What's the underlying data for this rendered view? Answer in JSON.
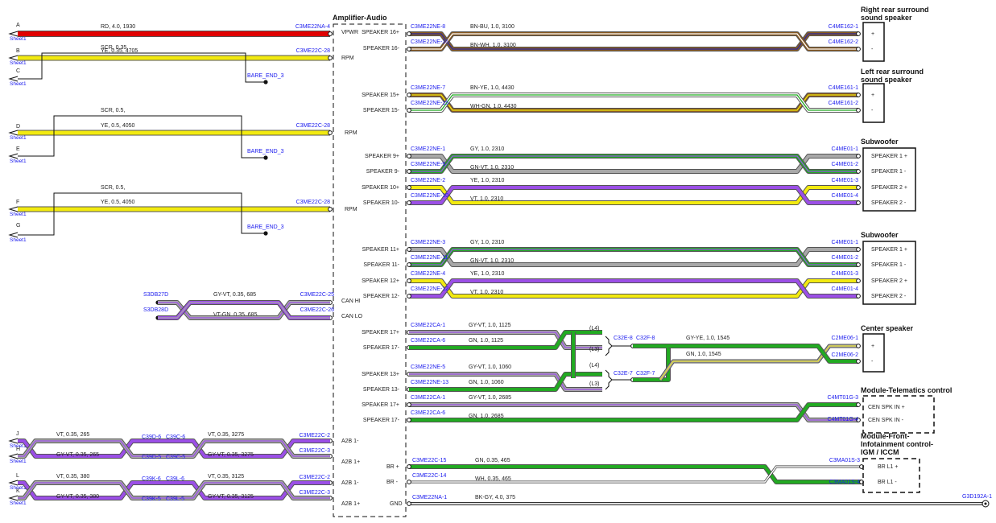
{
  "colors": {
    "RD": "#e00000",
    "YE": "#f2ea10",
    "BN": "#8a5a20",
    "BU": "#2a2aa0",
    "WH": "#ffffff",
    "GN": "#22aa22",
    "GY": "#a8a8a8",
    "VT": "#9b4fe6",
    "BK": "#222222",
    "connector_text": "#1a1aee"
  },
  "amplifier": {
    "title": "Amplifier-Audio",
    "pins": [
      "SPEAKER 16+",
      "SPEAKER 16-",
      "SPEAKER 15+",
      "SPEAKER 15-",
      "SPEAKER 9+",
      "SPEAKER 9-",
      "SPEAKER 10+",
      "SPEAKER 10-",
      "SPEAKER 11+",
      "SPEAKER 11-",
      "SPEAKER 12+",
      "SPEAKER 12-",
      "SPEAKER 17+",
      "SPEAKER 17-",
      "SPEAKER 13+",
      "SPEAKER 13-",
      "SPEAKER 17+",
      "SPEAKER 17-"
    ],
    "pins_small": [
      "VPWR",
      "RPM",
      "RPM",
      "RPM",
      "CAN HI",
      "CAN LO",
      "A2B 1-",
      "A2B 1+",
      "A2B 1-",
      "A2B 1+",
      "BR +",
      "BR -",
      "GND"
    ]
  },
  "left_wires": [
    {
      "letter": "A",
      "sheet": "Sheet1",
      "label": "RD, 4.0, 1930",
      "conn": "C3ME22NA-4"
    },
    {
      "letter": "B",
      "sheet": "Sheet1",
      "label": "YE, 0.35, 4705",
      "conn": "C3ME22C-28",
      "shield": "SCR, 0.35,"
    },
    {
      "letter": "C",
      "sheet": "Sheet1",
      "bare": "BARE_END_3"
    },
    {
      "letter": "D",
      "sheet": "Sheet1",
      "label": "YE, 0.5, 4050",
      "conn": "C3ME22C-28",
      "shield": "SCR, 0.5,"
    },
    {
      "letter": "E",
      "sheet": "Sheet1",
      "bare": "BARE_END_3"
    },
    {
      "letter": "F",
      "sheet": "Sheet1",
      "label": "YE, 0.5, 4050",
      "conn": "C3ME22C-28",
      "shield": "SCR, 0.5,"
    },
    {
      "letter": "G",
      "sheet": "Sheet1",
      "bare": "BARE_END_3"
    }
  ],
  "can": [
    {
      "from": "S3DB27D",
      "label": "GY-VT, 0.35, 685",
      "conn": "C3ME22C-25"
    },
    {
      "from": "S3DB28D",
      "label": "VT-GN, 0.35, 685",
      "conn": "C3ME22C-26"
    }
  ],
  "a2b": [
    {
      "letter": "J",
      "sheet": "Sheet1",
      "l1": "VT, 0.35, 265",
      "c1": "C39D-6",
      "c2": "C39C-6",
      "l2": "VT, 0.35, 3275",
      "conn": "C3ME22C-2"
    },
    {
      "letter": "H",
      "sheet": "Sheet1",
      "l1": "GY-VT, 0.35, 265",
      "c1": "C39D-5",
      "c2": "C39C-5",
      "l2": "GY-VT, 0.35, 3275",
      "conn": "C3ME22C-3"
    },
    {
      "letter": "L",
      "sheet": "Sheet1",
      "l1": "VT, 0.35, 380",
      "c1": "C39K-6",
      "c2": "C39L-6",
      "l2": "VT, 0.35, 3125",
      "conn": "C3ME22C-2"
    },
    {
      "letter": "K",
      "sheet": "Sheet1",
      "l1": "GY-VT, 0.35, 380",
      "c1": "C39K-5",
      "c2": "C39L-5",
      "l2": "GY-VT, 0.35, 3125",
      "conn": "C3ME22C-3"
    }
  ],
  "right_wires": [
    {
      "conn": "C3ME22NE-8",
      "label": "BN-BU, 1.0, 3100",
      "dest": "C4ME162-1"
    },
    {
      "conn": "C3ME22NE-16",
      "label": "BN-WH, 1.0, 3100",
      "dest": "C4ME162-2"
    },
    {
      "conn": "C3ME22NE-7",
      "label": "BN-YE, 1.0, 4430",
      "dest": "C4ME161-1"
    },
    {
      "conn": "C3ME22NE-15",
      "label": "WH-GN, 1.0, 4430",
      "dest": "C4ME161-2"
    },
    {
      "conn": "C3ME22NE-1",
      "label": "GY, 1.0, 2310",
      "dest": "C4ME01-1"
    },
    {
      "conn": "C3ME22NE-9",
      "label": "GN-VT, 1.0, 2310",
      "dest": "C4ME01-2"
    },
    {
      "conn": "C3ME22NE-2",
      "label": "YE, 1.0, 2310",
      "dest": "C4ME01-3"
    },
    {
      "conn": "C3ME22NE-10",
      "label": "VT, 1.0, 2310",
      "dest": "C4ME01-4"
    },
    {
      "conn": "C3ME22NE-3",
      "label": "GY, 1.0, 2310",
      "dest": "C4ME01-1"
    },
    {
      "conn": "C3ME22NE-11",
      "label": "GN-VT, 1.0, 2310",
      "dest": "C4ME01-2"
    },
    {
      "conn": "C3ME22NE-4",
      "label": "YE, 1.0, 2310",
      "dest": "C4ME01-3"
    },
    {
      "conn": "C3ME22NE-12",
      "label": "VT, 1.0, 2310",
      "dest": "C4ME01-4"
    },
    {
      "conn": "C3ME22CA-1",
      "label": "GY-VT, 1.0, 1125"
    },
    {
      "conn": "C3ME22CA-6",
      "label": "GN, 1.0, 1125"
    },
    {
      "conn": "C3ME22NE-5",
      "label": "GY-VT, 1.0, 1060"
    },
    {
      "conn": "C3ME22NE-13",
      "label": "GN, 1.0, 1060"
    },
    {
      "conn": "C3ME22CA-1",
      "label": "GY-VT, 1.0, 2685",
      "dest": "C4MT01G-3"
    },
    {
      "conn": "C3ME22CA-6",
      "label": "GN, 1.0, 2685",
      "dest": "C4MT01G-4"
    },
    {
      "conn": "C3ME22C-15",
      "label": "GN, 0.35, 465",
      "dest": "C3MA01S-3"
    },
    {
      "conn": "C3ME22C-14",
      "label": "WH, 0.35, 465",
      "dest": "C3MA01S-4"
    },
    {
      "conn": "C3ME22NA-1",
      "label": "BK-GY, 4.0, 375",
      "dest": "G3D192A-1"
    }
  ],
  "center": {
    "splice_refs": [
      "(L4)",
      "(L3)",
      "(L4)",
      "(L3)"
    ],
    "c1": "C32E-8",
    "c2": "C32F-8",
    "c3": "C32E-7",
    "c4": "C32F-7",
    "l1": "GY-YE, 1.0, 1545",
    "l2": "GN, 1.0, 1545",
    "d1": "C2ME06-1",
    "d2": "C2ME06-2"
  },
  "components": [
    {
      "title": "Right rear surround\nsound speaker",
      "pins": [
        "+",
        "-"
      ]
    },
    {
      "title": "Left rear surround\nsound speaker",
      "pins": [
        "+",
        "-"
      ]
    },
    {
      "title": "Subwoofer",
      "pins": [
        "SPEAKER 1 +",
        "SPEAKER 1 -",
        "SPEAKER 2 +",
        "SPEAKER 2 -"
      ]
    },
    {
      "title": "Subwoofer",
      "pins": [
        "SPEAKER 1 +",
        "SPEAKER 1 -",
        "SPEAKER 2 +",
        "SPEAKER 2 -"
      ]
    },
    {
      "title": "Center speaker",
      "pins": [
        "+",
        "-"
      ]
    },
    {
      "title": "Module-Telematics control",
      "pins": [
        "CEN SPK IN +",
        "CEN SPK IN -"
      ]
    },
    {
      "title": "Module-Front-\nInfotainment control-\nIGM / ICCM",
      "pins": [
        "BR L1 +",
        "BR L1 -"
      ]
    }
  ]
}
